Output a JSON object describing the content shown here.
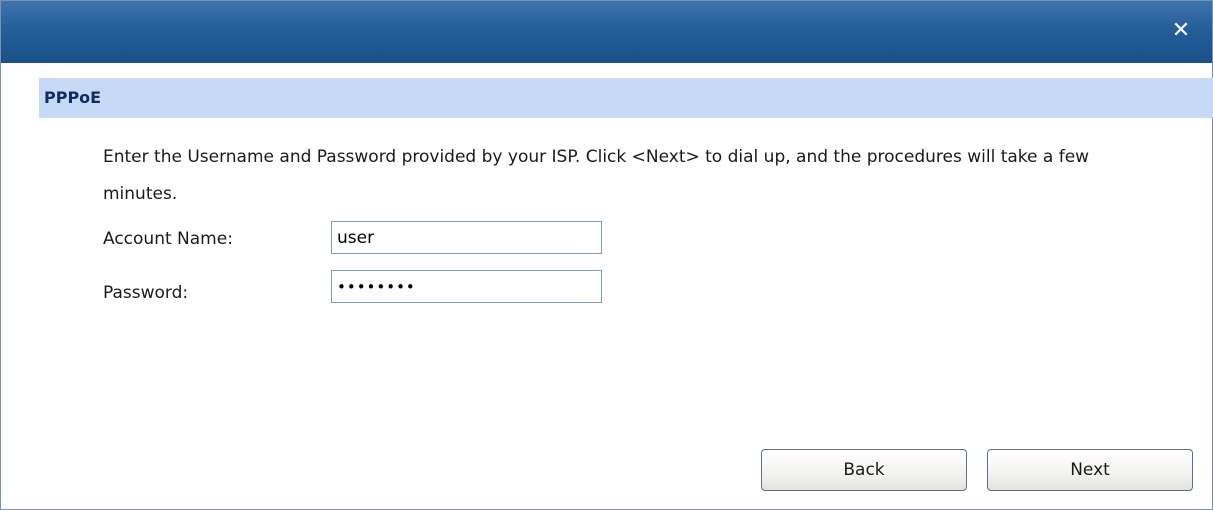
{
  "dialog": {
    "close_glyph": "✕"
  },
  "section": {
    "title": "PPPoE"
  },
  "description": "Enter the Username and Password provided by your ISP. Click <Next> to dial up, and the procedures will take a few minutes.",
  "form": {
    "account_label": "Account Name:",
    "account_value": "user",
    "password_label": "Password:",
    "password_value": "••••••••"
  },
  "buttons": {
    "back_label": "Back",
    "next_label": "Next"
  },
  "colors": {
    "titlebar": "#245f99",
    "section_header_bg": "#c6d9f7",
    "section_title": "#0d2e63",
    "input_border": "#7f9db9"
  }
}
